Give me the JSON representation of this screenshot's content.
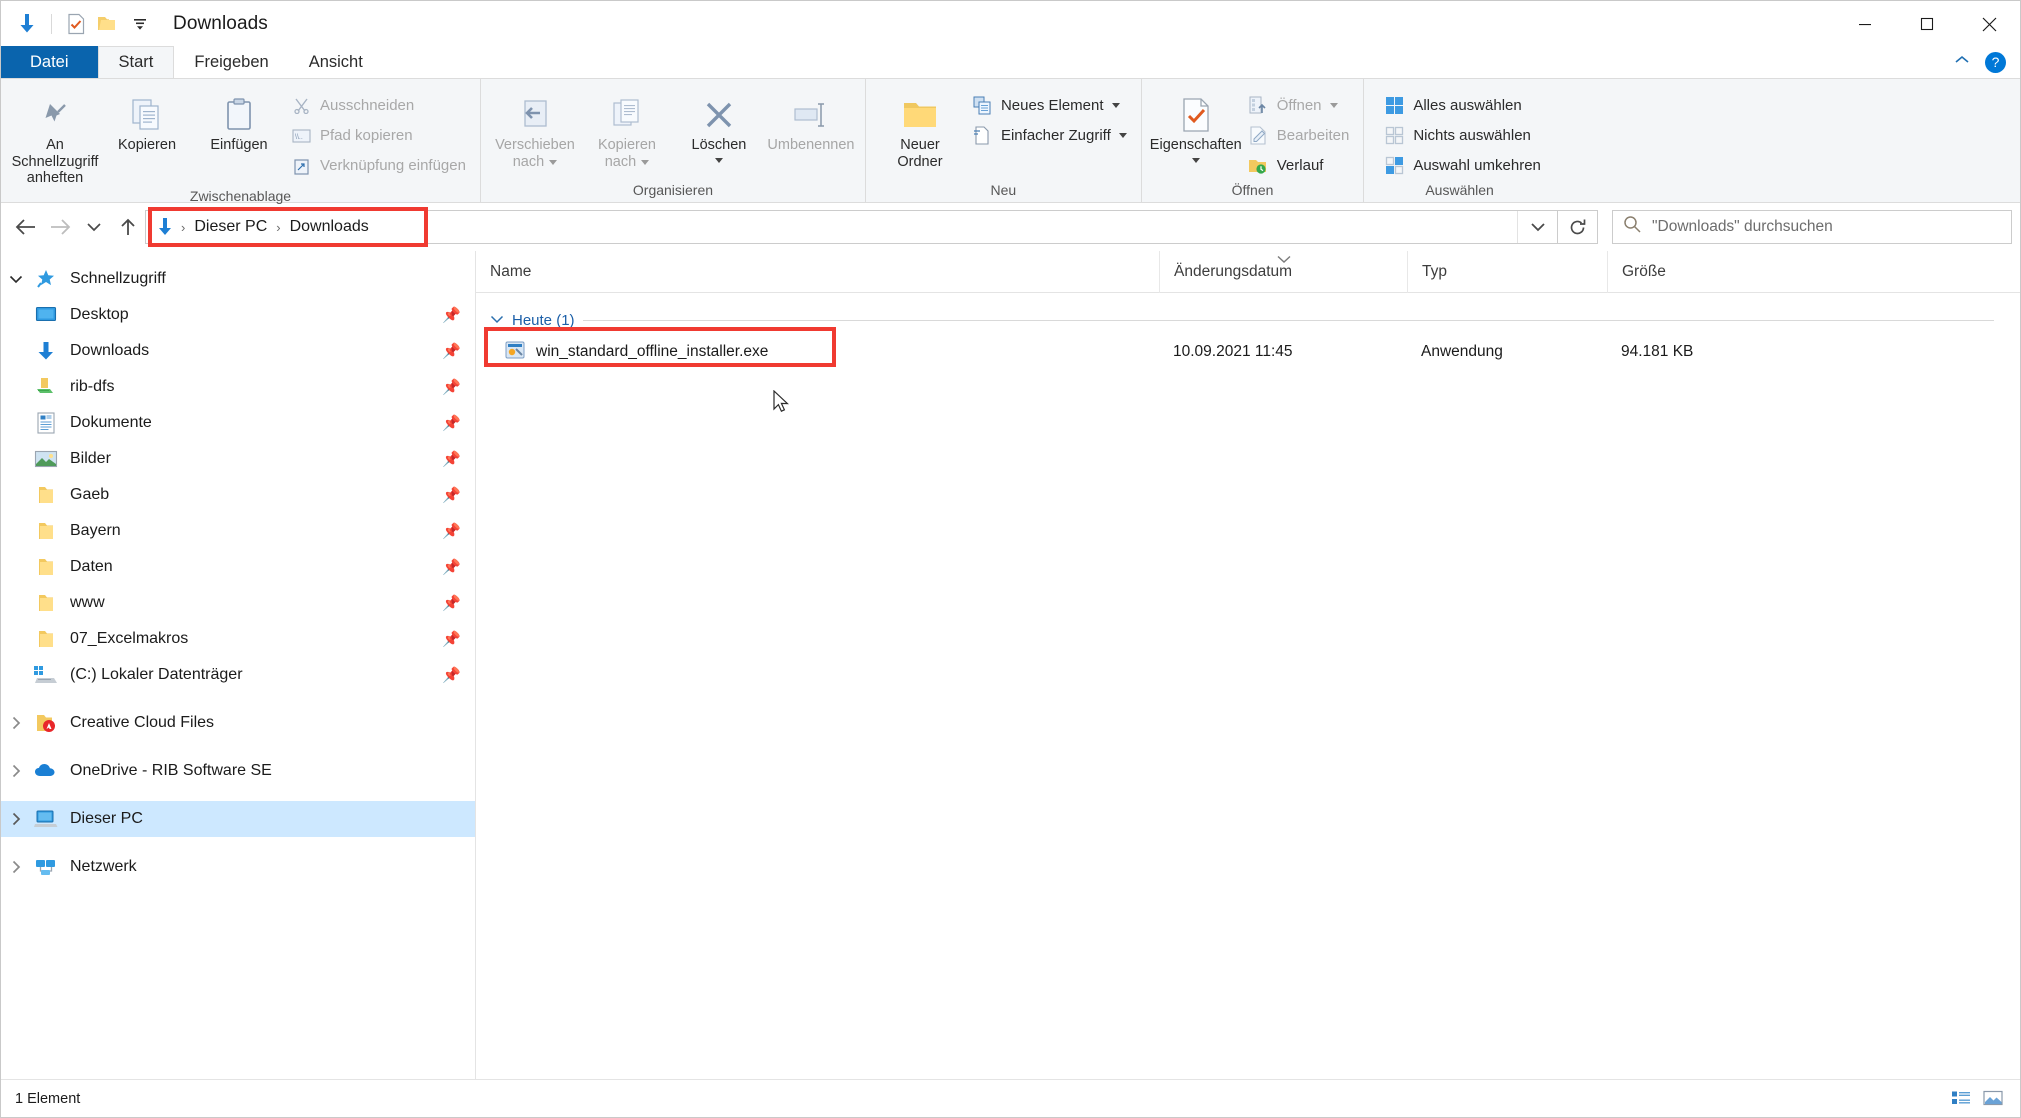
{
  "window": {
    "title": "Downloads",
    "quick_access": [
      "download-icon",
      "properties-check-icon",
      "folder-icon",
      "customize-chevron-icon"
    ],
    "caption": {
      "minimize": "minimize-icon",
      "maximize": "maximize-icon",
      "close": "close-icon"
    }
  },
  "tabs": [
    {
      "label": "Datei",
      "state": "file"
    },
    {
      "label": "Start",
      "state": "active"
    },
    {
      "label": "Freigeben",
      "state": "normal"
    },
    {
      "label": "Ansicht",
      "state": "normal"
    }
  ],
  "tab_right": {
    "collapse": "chevron-up-icon",
    "help": "?"
  },
  "ribbon": {
    "groups": [
      {
        "name": "Zwischenablage",
        "big": [
          {
            "label_line1": "An Schnellzugriff",
            "label_line2": "anheften",
            "icon": "pin-icon",
            "disabled": false
          },
          {
            "label_line1": "Kopieren",
            "label_line2": "",
            "icon": "copy-icon",
            "disabled": false
          },
          {
            "label_line1": "Einfügen",
            "label_line2": "",
            "icon": "paste-icon",
            "disabled": false
          }
        ],
        "small": [
          {
            "label": "Ausschneiden",
            "icon": "scissors-icon",
            "disabled": true
          },
          {
            "label": "Pfad kopieren",
            "icon": "copy-path-icon",
            "disabled": true
          },
          {
            "label": "Verknüpfung einfügen",
            "icon": "paste-shortcut-icon",
            "disabled": true
          }
        ]
      },
      {
        "name": "Organisieren",
        "big": [
          {
            "label_line1": "Verschieben",
            "label_line2": "nach",
            "icon": "move-to-icon",
            "dropdown": true,
            "disabled": true
          },
          {
            "label_line1": "Kopieren",
            "label_line2": "nach",
            "icon": "copy-to-icon",
            "dropdown": true,
            "disabled": true
          },
          {
            "label_line1": "Löschen",
            "label_line2": "",
            "icon": "delete-x-icon",
            "dropdown": true,
            "disabled": false
          },
          {
            "label_line1": "Umbenennen",
            "label_line2": "",
            "icon": "rename-icon",
            "dropdown": false,
            "disabled": true
          }
        ],
        "small": []
      },
      {
        "name": "Neu",
        "big": [
          {
            "label_line1": "Neuer",
            "label_line2": "Ordner",
            "icon": "new-folder-icon",
            "disabled": false
          }
        ],
        "small": [
          {
            "label": "Neues Element",
            "icon": "new-item-icon",
            "dropdown": true,
            "disabled": false
          },
          {
            "label": "Einfacher Zugriff",
            "icon": "easy-access-icon",
            "dropdown": true,
            "disabled": false
          }
        ]
      },
      {
        "name": "Öffnen",
        "big": [
          {
            "label_line1": "Eigenschaften",
            "label_line2": "",
            "icon": "properties-check-icon",
            "dropdown": true,
            "disabled": false
          }
        ],
        "small": [
          {
            "label": "Öffnen",
            "icon": "open-icon",
            "dropdown": true,
            "disabled": true
          },
          {
            "label": "Bearbeiten",
            "icon": "edit-icon",
            "disabled": true
          },
          {
            "label": "Verlauf",
            "icon": "history-icon",
            "disabled": false
          }
        ]
      },
      {
        "name": "Auswählen",
        "big": [],
        "small": [
          {
            "label": "Alles auswählen",
            "icon": "select-all-icon",
            "disabled": false
          },
          {
            "label": "Nichts auswählen",
            "icon": "select-none-icon",
            "disabled": false
          },
          {
            "label": "Auswahl umkehren",
            "icon": "invert-selection-icon",
            "disabled": false
          }
        ]
      }
    ]
  },
  "addressbar": {
    "back": "back-arrow-icon",
    "forward": "forward-arrow-icon",
    "recent": "chevron-down-icon",
    "up": "up-arrow-icon",
    "location_icon": "download-icon",
    "breadcrumbs": [
      "Dieser PC",
      "Downloads"
    ],
    "dropdown": "chevron-down-icon",
    "refresh": "refresh-icon",
    "search": {
      "icon": "search-icon",
      "placeholder": "\"Downloads\" durchsuchen",
      "value": ""
    }
  },
  "sidebar": {
    "items": [
      {
        "label": "Schnellzugriff",
        "icon": "star-pin-icon",
        "chevron": "expanded",
        "indent": 0,
        "pinned": false,
        "selected": false
      },
      {
        "label": "Desktop",
        "icon": "desktop-icon",
        "chevron": "none",
        "indent": 1,
        "pinned": true,
        "selected": false
      },
      {
        "label": "Downloads",
        "icon": "download-icon",
        "chevron": "none",
        "indent": 1,
        "pinned": true,
        "selected": false
      },
      {
        "label": "rib-dfs",
        "icon": "network-folder-icon",
        "chevron": "none",
        "indent": 1,
        "pinned": true,
        "selected": false
      },
      {
        "label": "Dokumente",
        "icon": "documents-icon",
        "chevron": "none",
        "indent": 1,
        "pinned": true,
        "selected": false
      },
      {
        "label": "Bilder",
        "icon": "pictures-icon",
        "chevron": "none",
        "indent": 1,
        "pinned": true,
        "selected": false
      },
      {
        "label": "Gaeb",
        "icon": "folder-icon",
        "chevron": "none",
        "indent": 1,
        "pinned": true,
        "selected": false
      },
      {
        "label": "Bayern",
        "icon": "folder-icon",
        "chevron": "none",
        "indent": 1,
        "pinned": true,
        "selected": false
      },
      {
        "label": "Daten",
        "icon": "folder-icon",
        "chevron": "none",
        "indent": 1,
        "pinned": true,
        "selected": false
      },
      {
        "label": "www",
        "icon": "folder-icon",
        "chevron": "none",
        "indent": 1,
        "pinned": true,
        "selected": false
      },
      {
        "label": "07_Excelmakros",
        "icon": "folder-icon",
        "chevron": "none",
        "indent": 1,
        "pinned": true,
        "selected": false
      },
      {
        "label": "(C:) Lokaler Datenträger",
        "icon": "drive-icon",
        "chevron": "none",
        "indent": 1,
        "pinned": true,
        "selected": false
      },
      {
        "label": "Creative Cloud Files",
        "icon": "creative-cloud-icon",
        "chevron": "collapsed",
        "indent": 0,
        "pinned": false,
        "selected": false
      },
      {
        "label": "OneDrive - RIB Software SE",
        "icon": "onedrive-icon",
        "chevron": "collapsed",
        "indent": 0,
        "pinned": false,
        "selected": false
      },
      {
        "label": "Dieser PC",
        "icon": "this-pc-icon",
        "chevron": "collapsed",
        "indent": 0,
        "pinned": false,
        "selected": true
      },
      {
        "label": "Netzwerk",
        "icon": "network-icon",
        "chevron": "collapsed",
        "indent": 0,
        "pinned": false,
        "selected": false
      }
    ]
  },
  "filelist": {
    "columns": [
      {
        "label": "Name",
        "sorted": false
      },
      {
        "label": "Änderungsdatum",
        "sorted": true
      },
      {
        "label": "Typ",
        "sorted": false
      },
      {
        "label": "Größe",
        "sorted": false
      }
    ],
    "group": {
      "label": "Heute (1)",
      "chevron": "expanded"
    },
    "rows": [
      {
        "name": "win_standard_offline_installer.exe",
        "icon": "exe-installer-icon",
        "date": "10.09.2021 11:45",
        "type": "Anwendung",
        "size": "94.181 KB",
        "highlighted": true
      }
    ]
  },
  "statusbar": {
    "text": "1 Element",
    "views": [
      "details-view-icon",
      "large-icons-view-icon"
    ]
  },
  "annotations": {
    "color": "#f03a31",
    "boxes": [
      "breadcrumb-highlight",
      "file-row-highlight"
    ]
  }
}
